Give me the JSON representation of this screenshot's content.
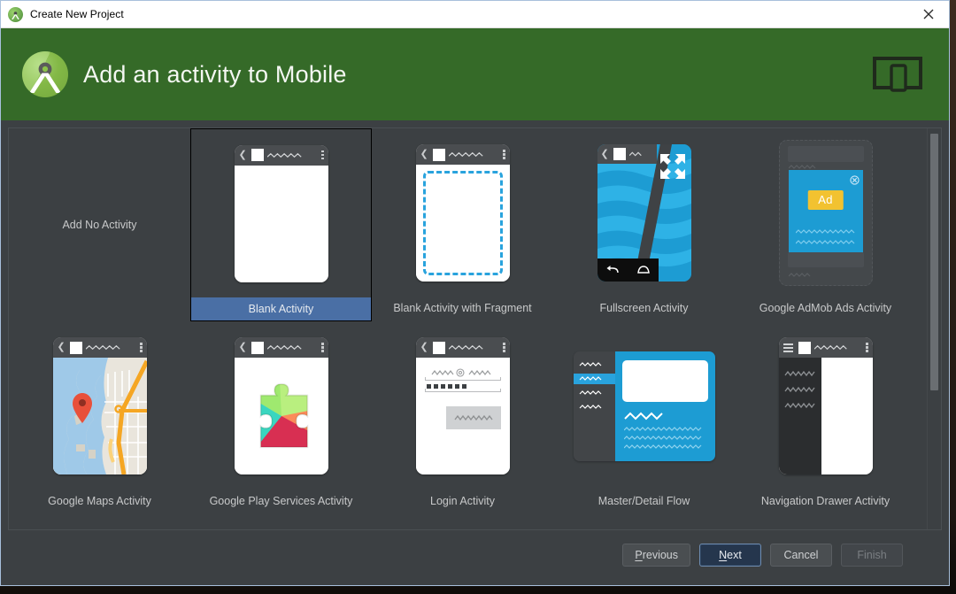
{
  "window": {
    "title": "Create New Project",
    "title_icon": "android-studio-icon",
    "close_icon": "close-icon"
  },
  "header": {
    "title": "Add an activity to Mobile",
    "logo_icon": "android-studio-logo",
    "device_icon": "mobile-device-icon",
    "background_color": "#356a28"
  },
  "gallery": {
    "selected": "Blank Activity",
    "rows": [
      {
        "cells": [
          {
            "label": "Add No Activity",
            "kind": "text-only"
          },
          {
            "label": "Blank Activity",
            "kind": "blank",
            "selected": true
          },
          {
            "label": "Blank Activity with Fragment",
            "kind": "fragment"
          },
          {
            "label": "Fullscreen Activity",
            "kind": "fullscreen"
          },
          {
            "label": "Google AdMob Ads Activity",
            "kind": "admob",
            "ad_label": "Ad"
          }
        ]
      },
      {
        "cells": [
          {
            "label": "Google Maps Activity",
            "kind": "maps"
          },
          {
            "label": "Google Play Services Activity",
            "kind": "play"
          },
          {
            "label": "Login Activity",
            "kind": "login"
          },
          {
            "label": "Master/Detail Flow",
            "kind": "masterdetail"
          },
          {
            "label": "Navigation Drawer Activity",
            "kind": "drawer"
          }
        ]
      }
    ]
  },
  "scrollbar": {
    "name": "vertical-scrollbar"
  },
  "footer": {
    "previous": {
      "prefix": "P",
      "rest": "revious"
    },
    "next": {
      "prefix": "N",
      "rest": "ext"
    },
    "cancel": "Cancel",
    "finish": "Finish"
  },
  "colors": {
    "accent_blue": "#4a6fa5",
    "android_blue": "#1d9cd3",
    "header_green": "#356a28",
    "panel": "#3c4043"
  }
}
